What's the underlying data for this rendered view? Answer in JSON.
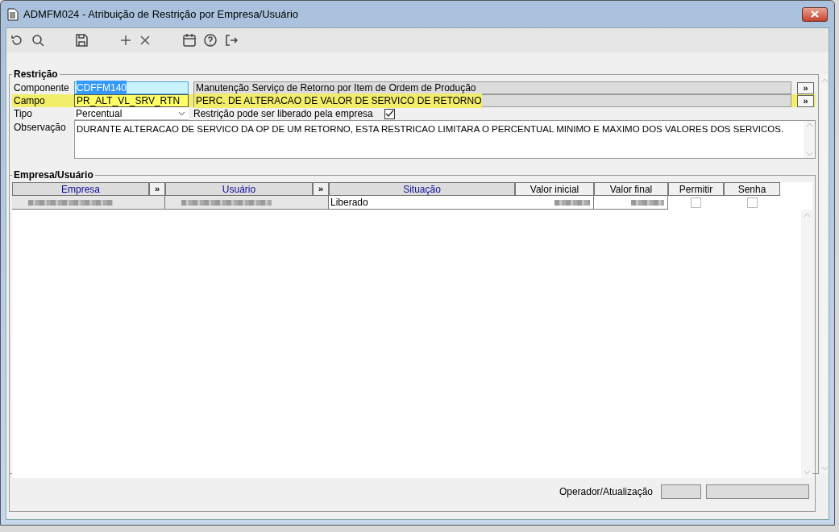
{
  "window": {
    "title": "ADMFM024 - Atribuição de Restrição por Empresa/Usuário"
  },
  "restricao": {
    "title": "Restrição",
    "lookups": [
      {
        "label": "Componente",
        "value": "CDFFM140",
        "value_selected": true,
        "description": "Manutenção Serviço de Retorno por Item de Ordem de Produção",
        "highlighted": false,
        "button": "»"
      },
      {
        "label": "Campo",
        "value": "PR_ALT_VL_SRV_RTN",
        "value_selected": false,
        "description": "PERC. DE ALTERACAO DE VALOR DE SERVICO DE RETORNO",
        "highlighted": true,
        "button": "»"
      }
    ],
    "tipo": {
      "label": "Tipo",
      "value": "Percentual"
    },
    "liberavel": {
      "label": "Restrição pode ser liberado pela empresa",
      "checked": true
    },
    "observacao": {
      "label": "Observação",
      "value": "DURANTE ALTERACAO DE SERVICO DA OP DE UM RETORNO, ESTA RESTRICAO LIMITARA O PERCENTUAL MINIMO E MAXIMO DOS VALORES DOS SERVICOS."
    }
  },
  "grid": {
    "title": "Empresa/Usuário",
    "columns": [
      {
        "label": "Empresa",
        "kind": "lookup",
        "button": "»"
      },
      {
        "label": "Usuário",
        "kind": "lookup",
        "button": "»"
      },
      {
        "label": "Situação",
        "kind": "lookup"
      },
      {
        "label": "Valor inicial",
        "kind": "plain"
      },
      {
        "label": "Valor final",
        "kind": "plain"
      },
      {
        "label": "Permitir",
        "kind": "plain"
      },
      {
        "label": "Senha",
        "kind": "plain"
      }
    ],
    "rows": [
      {
        "cells": [
          {
            "kind": "redacted"
          },
          {
            "kind": "redacted"
          },
          {
            "kind": "text",
            "text": "Liberado"
          },
          {
            "kind": "redacted"
          },
          {
            "kind": "redacted"
          },
          {
            "kind": "checkbox",
            "checked": false
          },
          {
            "kind": "checkbox",
            "checked": false
          }
        ]
      }
    ]
  },
  "footer": {
    "label": "Operador/Atualização"
  }
}
